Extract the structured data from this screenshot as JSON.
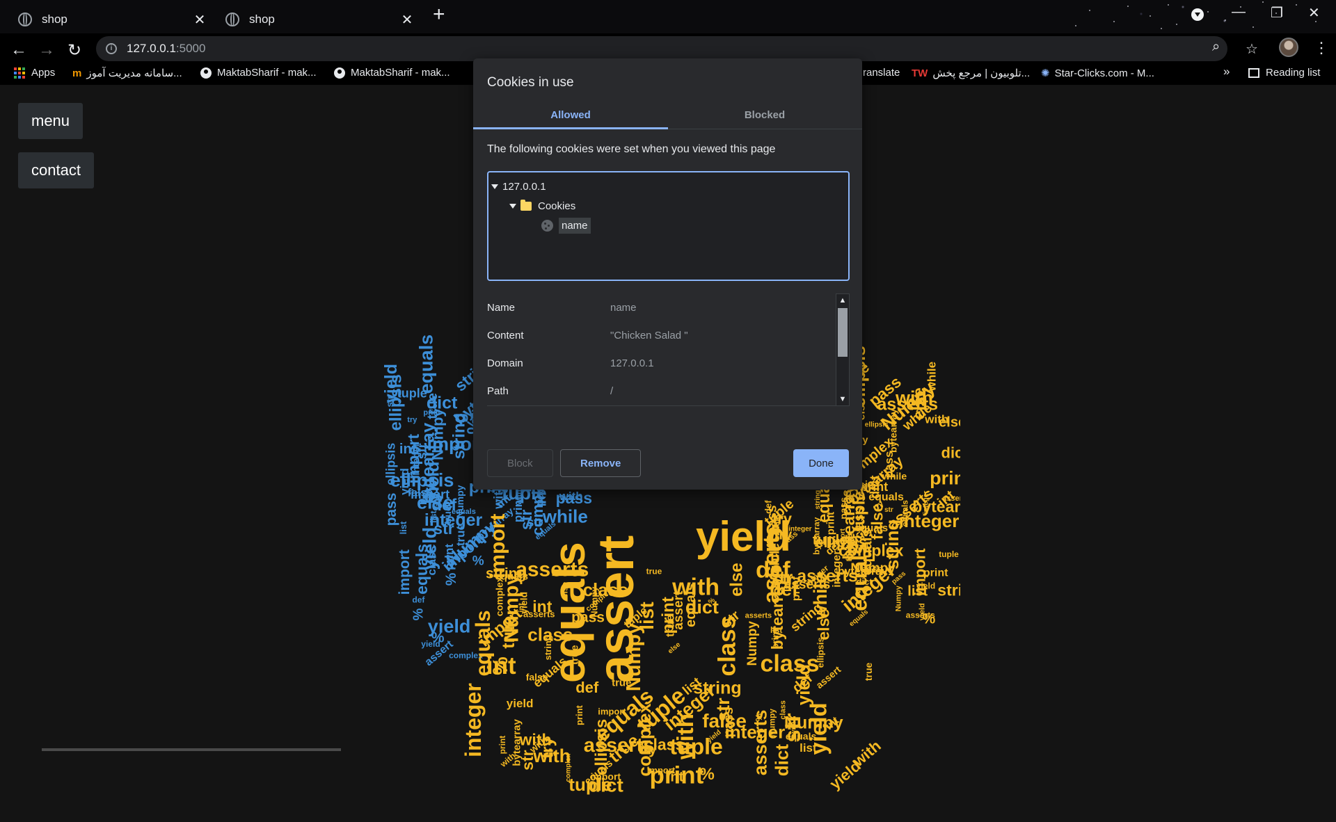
{
  "browser": {
    "tabs": [
      {
        "title": "shop"
      },
      {
        "title": "shop"
      }
    ],
    "url_host": "127.0.0.1",
    "url_port": ":5000",
    "bookmarks": [
      {
        "label": "Apps"
      },
      {
        "label": "سامانه مدیریت آموز..."
      },
      {
        "label": "MaktabSharif - mak..."
      },
      {
        "label": "MaktabSharif - mak..."
      },
      {
        "label": "ranslate"
      },
      {
        "label": "تلوبیون | مرجع پخش..."
      },
      {
        "label": "Star-Clicks.com - M..."
      }
    ],
    "reading_list": "Reading list",
    "tw_badge": "TW",
    "more_chevron": "»"
  },
  "page": {
    "menu_label": "menu",
    "contact_label": "contact",
    "wordcloud_words": [
      "equals",
      "assert",
      "yield",
      "string",
      "import",
      "class",
      "tuple",
      "ellipsis",
      "false",
      "true",
      "while",
      "try",
      "dict",
      "int",
      "bytearray",
      "complex",
      "print",
      "else",
      "list",
      "with",
      "def",
      "pass",
      "str",
      "asserts",
      "%",
      "Numpy",
      "integer"
    ]
  },
  "dialog": {
    "title": "Cookies in use",
    "tab_allowed": "Allowed",
    "tab_blocked": "Blocked",
    "description": "The following cookies were set when you viewed this page",
    "tree": {
      "host": "127.0.0.1",
      "folder": "Cookies",
      "cookie": "name"
    },
    "details": [
      {
        "key": "Name",
        "value": "name"
      },
      {
        "key": "Content",
        "value": "\"Chicken Salad \""
      },
      {
        "key": "Domain",
        "value": "127.0.0.1"
      },
      {
        "key": "Path",
        "value": "/"
      }
    ],
    "btn_block": "Block",
    "btn_remove": "Remove",
    "btn_done": "Done"
  },
  "colors": {
    "accent": "#8ab4f8",
    "cloud_blue": "#3d8fd8",
    "cloud_yellow": "#f5b922"
  }
}
